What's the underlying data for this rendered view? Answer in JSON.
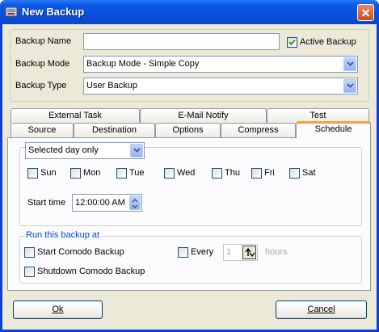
{
  "window": {
    "title": "New Backup",
    "icon": "backup-app-icon"
  },
  "form": {
    "backup_name_label": "Backup Name",
    "backup_name_value": "",
    "active_backup_label": "Active Backup",
    "active_backup_checked": true,
    "backup_mode_label": "Backup Mode",
    "backup_mode_value": "Backup Mode - Simple Copy",
    "backup_type_label": "Backup Type",
    "backup_type_value": "User Backup"
  },
  "tabs_back": [
    "External Task",
    "E-Mail Notify",
    "Test"
  ],
  "tabs_front": [
    "Source",
    "Destination",
    "Options",
    "Compress",
    "Schedule"
  ],
  "active_tab": "Schedule",
  "schedule": {
    "frequency_value": "Selected day only",
    "days": [
      {
        "label": "Sun",
        "checked": false
      },
      {
        "label": "Mon",
        "checked": false
      },
      {
        "label": "Tue",
        "checked": false
      },
      {
        "label": "Wed",
        "checked": false
      },
      {
        "label": "Thu",
        "checked": false
      },
      {
        "label": "Fri",
        "checked": false
      },
      {
        "label": "Sat",
        "checked": false
      }
    ],
    "start_time_label": "Start time",
    "start_time_value": "12:00:00 AM"
  },
  "run_at": {
    "legend": "Run this backup at",
    "start_label": "Start Comodo Backup",
    "shutdown_label": "Shutdown Comodo Backup",
    "every_label": "Every",
    "every_value": "1",
    "hours_label": "hours"
  },
  "buttons": {
    "ok": "Ok",
    "cancel": "Cancel"
  },
  "colors": {
    "title_bar": "#0a5ae8",
    "client_bg": "#ece9d8",
    "active_tab_accent": "#f2a23a",
    "check_green": "#21a121"
  }
}
